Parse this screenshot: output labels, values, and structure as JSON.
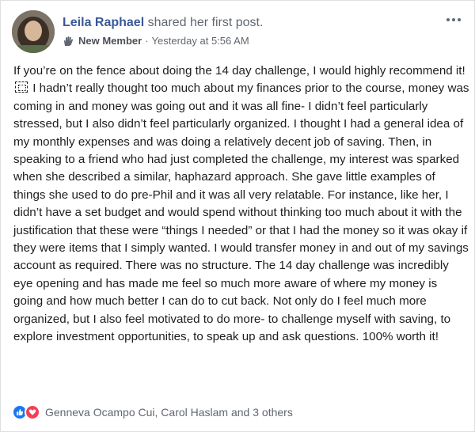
{
  "post": {
    "author": "Leila Raphael",
    "action": " shared her first post.",
    "badge_label": "New Member",
    "separator": "·",
    "timestamp": "Yesterday at 5:56 AM",
    "icons": {
      "avatar": "profile-photo",
      "badge": "waving-hand-icon",
      "more": "more-options-icon"
    },
    "text_part1": "If you’re on the fence about doing the 14 day challenge, I would highly recommend it!",
    "text_part2": " I hadn’t really thought too much about my finances prior to the course, money was coming in and money was going out and it was all fine- I didn’t feel particularly stressed, but I also didn’t feel particularly organized. I thought I had a general idea of my monthly expenses and was doing a relatively decent job of saving. Then, in speaking to a friend who had just completed the challenge, my interest was sparked when she described a similar, haphazard approach. She gave little examples of things she used to do pre-Phil and it was all very relatable. For instance, like her, I didn’t have a set budget and would spend without thinking too much about it with the justification that these were “things I needed” or that I had the money so it was okay if they were items that I simply wanted. I would transfer money in and out of my savings account as required. There was no structure. The 14 day challenge was incredibly eye opening and has made me feel so much more aware of where my money is going and how much better I can do to cut back. Not only do I feel much more organized, but I also feel motivated to do more- to challenge myself with saving, to explore investment opportunities, to speak up and ask questions. 100% worth it!"
  },
  "reactions": {
    "summary": "Genneva Ocampo Cui, Carol Haslam and 3 others",
    "types": [
      "like-icon",
      "love-icon"
    ],
    "colors": {
      "like": "#1877f2",
      "love": "#f33e58"
    }
  }
}
